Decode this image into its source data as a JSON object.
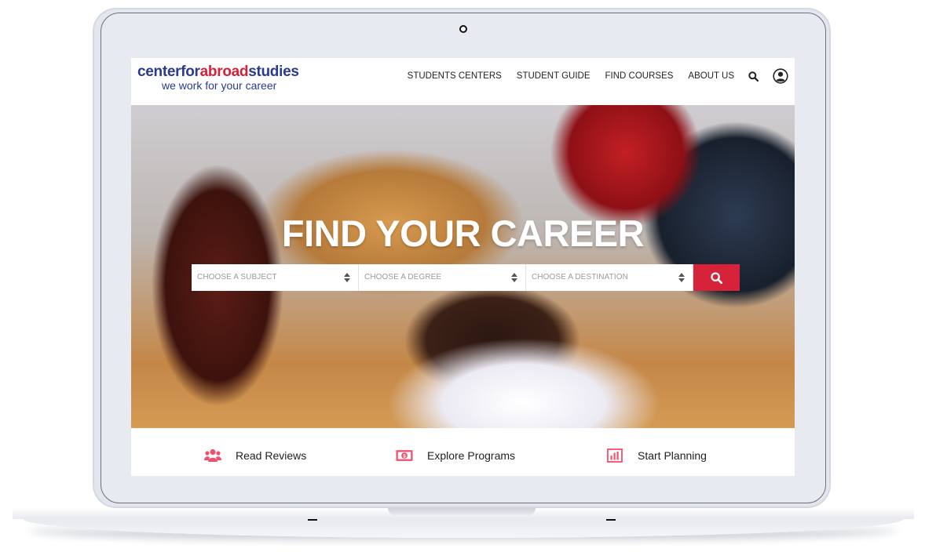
{
  "logo": {
    "part1": "centerfor",
    "part2": "abroad",
    "part3": "studies",
    "tagline": "we work for your career"
  },
  "nav": {
    "items": [
      "STUDENTS CENTERS",
      "STUDENT GUIDE",
      "FIND COURSES",
      "ABOUT US"
    ],
    "icons": [
      "search-icon",
      "user-account-icon"
    ]
  },
  "hero": {
    "title": "FIND YOUR CAREER",
    "selects": [
      "CHOOSE A SUBJECT",
      "CHOOSE A DEGREE",
      "CHOOSE A DESTINATION"
    ],
    "search_button_icon": "search-icon"
  },
  "features": [
    {
      "label": "Read Reviews",
      "icon": "people-group-icon"
    },
    {
      "label": "Explore Programs",
      "icon": "money-bill-icon"
    },
    {
      "label": "Start Planning",
      "icon": "bar-chart-icon"
    }
  ],
  "colors": {
    "brand_blue": "#2a3a8f",
    "brand_red": "#d81f3a",
    "accent_red": "#d7233a",
    "feature_icon": "#f0506e"
  }
}
